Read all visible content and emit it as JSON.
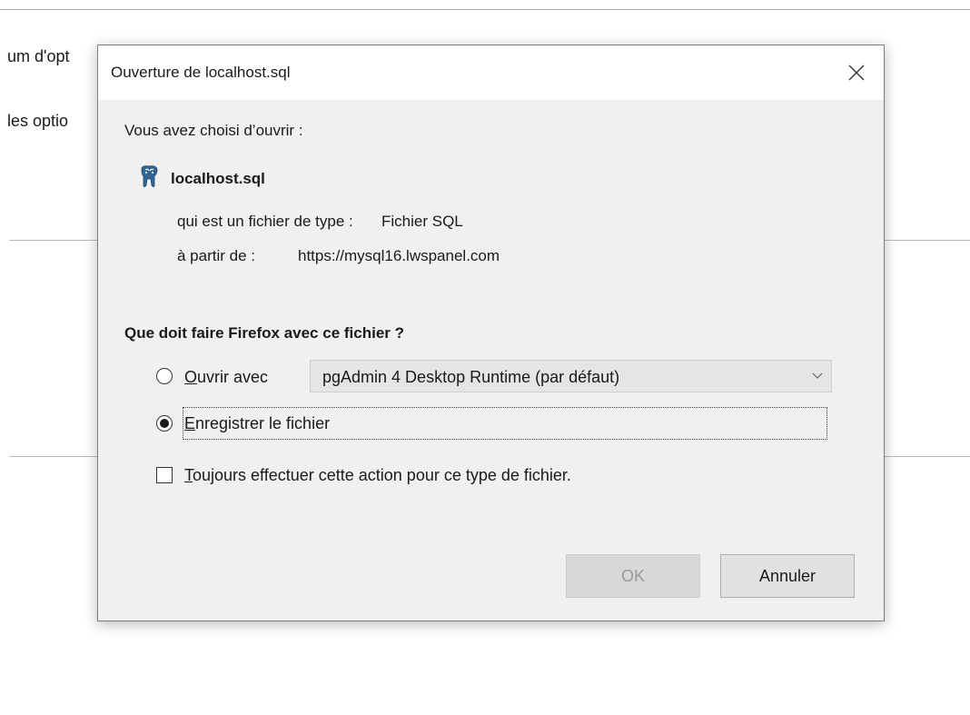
{
  "background": {
    "text_line1": "um d'opt",
    "text_line2": "les optio"
  },
  "dialog": {
    "title": "Ouverture de localhost.sql",
    "close_icon": "close-icon",
    "intro": "Vous avez choisi d’ouvrir :",
    "file_name": "localhost.sql",
    "file_icon": "postgresql-elephant-icon",
    "file_type_label": "qui est un fichier de type :",
    "file_type_value": "Fichier SQL",
    "source_label": "à partir de :",
    "source_value": "https://mysql16.lwspanel.com",
    "question": "Que doit faire Firefox avec ce fichier ?",
    "open_with": {
      "accesskey": "O",
      "label_rest": "uvrir avec",
      "checked": false,
      "selected_app": "pgAdmin 4 Desktop Runtime (par défaut)"
    },
    "save_file": {
      "accesskey": "E",
      "label_rest": "nregistrer le fichier",
      "checked": true
    },
    "always": {
      "accesskey": "T",
      "label_rest": "oujours effectuer cette action pour ce type de fichier.",
      "checked": false
    },
    "ok_label": "OK",
    "cancel_label": "Annuler"
  }
}
